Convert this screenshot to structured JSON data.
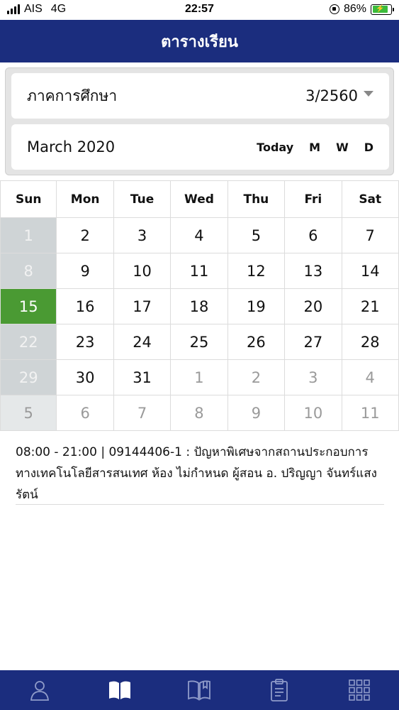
{
  "status_bar": {
    "carrier": "AIS",
    "network": "4G",
    "time": "22:57",
    "battery": "86%"
  },
  "header": {
    "title": "ตารางเรียน"
  },
  "semester": {
    "label": "ภาคการศึกษา",
    "value": "3/2560"
  },
  "month": {
    "label": "March 2020",
    "views": {
      "today": "Today",
      "month": "M",
      "week": "W",
      "day": "D"
    }
  },
  "calendar": {
    "weekdays": [
      "Sun",
      "Mon",
      "Tue",
      "Wed",
      "Thu",
      "Fri",
      "Sat"
    ],
    "weeks": [
      [
        "1",
        "2",
        "3",
        "4",
        "5",
        "6",
        "7"
      ],
      [
        "8",
        "9",
        "10",
        "11",
        "12",
        "13",
        "14"
      ],
      [
        "15",
        "16",
        "17",
        "18",
        "19",
        "20",
        "21"
      ],
      [
        "22",
        "23",
        "24",
        "25",
        "26",
        "27",
        "28"
      ],
      [
        "29",
        "30",
        "31",
        "1",
        "2",
        "3",
        "4"
      ],
      [
        "5",
        "6",
        "7",
        "8",
        "9",
        "10",
        "11"
      ]
    ],
    "today_color": "#4a9a33"
  },
  "event": {
    "text": "08:00 - 21:00 | 09144406-1 : ปัญหาพิเศษจากสถานประกอบการทางเทคโนโลยีสารสนเทศ ห้อง ไม่กำหนด ผู้สอน อ. ปริญญา จันทร์แสงรัตน์"
  },
  "bottom_nav": {
    "items": [
      "profile-icon",
      "book-open-icon",
      "bookmark-book-icon",
      "clipboard-icon",
      "grid-menu-icon"
    ]
  },
  "colors": {
    "brand": "#1b2d7e"
  }
}
